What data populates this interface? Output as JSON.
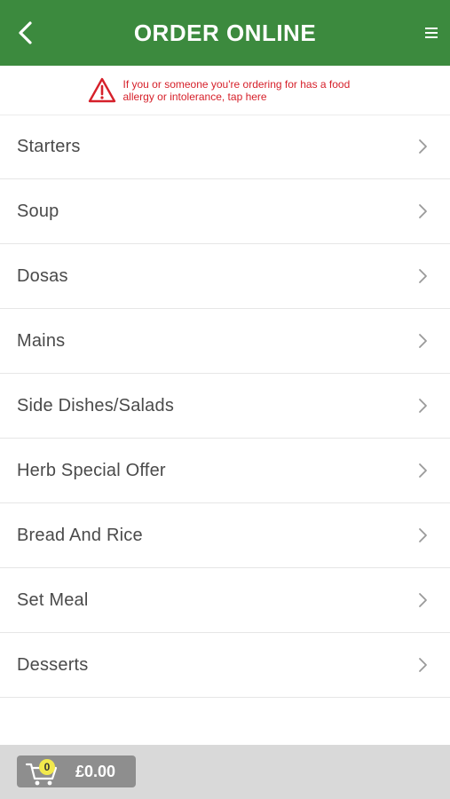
{
  "header": {
    "title": "ORDER ONLINE",
    "back_icon": "chevron-left-icon",
    "menu_icon": "hamburger-menu-icon",
    "background_color": "#3c8a3e"
  },
  "allergy_notice": {
    "icon": "warning-triangle-icon",
    "text": "If you or someone you're ordering for has a food allergy or intolerance, tap here",
    "color": "#d6202a"
  },
  "menu": {
    "items": [
      {
        "label": "Starters"
      },
      {
        "label": "Soup"
      },
      {
        "label": "Dosas"
      },
      {
        "label": "Mains"
      },
      {
        "label": "Side Dishes/Salads"
      },
      {
        "label": "Herb Special Offer"
      },
      {
        "label": "Bread And Rice"
      },
      {
        "label": "Set Meal"
      },
      {
        "label": "Desserts"
      }
    ]
  },
  "cart": {
    "count": "0",
    "total": "£0.00",
    "icon": "shopping-cart-icon"
  }
}
